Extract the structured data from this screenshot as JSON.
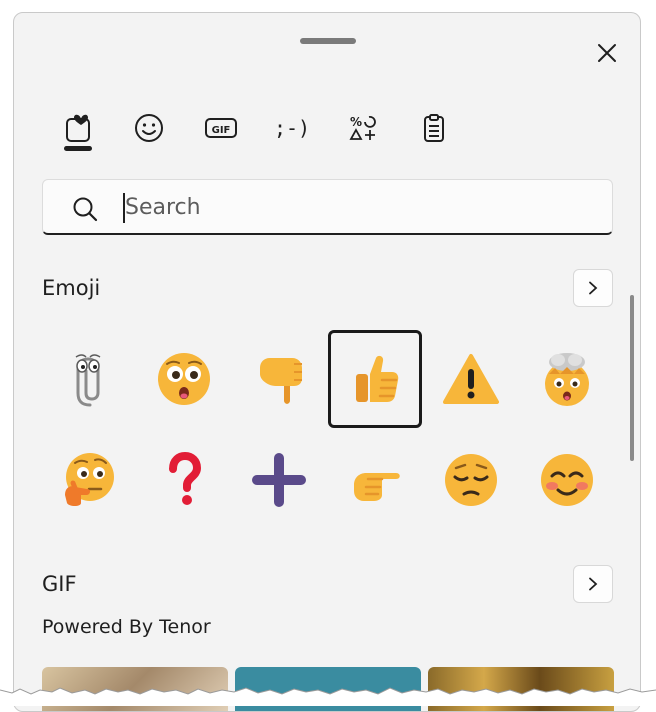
{
  "window": {
    "close_icon": "close-icon",
    "handle": "drag-handle"
  },
  "tabs": [
    {
      "name": "favorites",
      "icon": "heart-clipboard-icon",
      "active": true
    },
    {
      "name": "emoji",
      "icon": "smiley-icon",
      "active": false
    },
    {
      "name": "gif",
      "icon": "gif-icon",
      "label": "GIF",
      "active": false
    },
    {
      "name": "kaomoji",
      "icon": "kaomoji-icon",
      "label": ";-)",
      "active": false
    },
    {
      "name": "symbols",
      "icon": "symbols-icon",
      "label": "%↻Δ+",
      "active": false
    },
    {
      "name": "clipboard",
      "icon": "clipboard-icon",
      "active": false
    }
  ],
  "search": {
    "placeholder": "Search",
    "value": ""
  },
  "emoji_section": {
    "title": "Emoji",
    "items_row1": [
      {
        "name": "paperclip-character",
        "icon": "paperclip-icon"
      },
      {
        "name": "flushed-face",
        "icon": "flushed-face-icon"
      },
      {
        "name": "backhand-index-pointing-down",
        "icon": "pointing-down-icon"
      },
      {
        "name": "thumbs-up",
        "icon": "thumbs-up-icon",
        "selected": true
      },
      {
        "name": "warning",
        "icon": "warning-icon"
      },
      {
        "name": "exploding-head",
        "icon": "exploding-head-icon"
      }
    ],
    "items_row2": [
      {
        "name": "thinking-face",
        "icon": "thinking-face-icon"
      },
      {
        "name": "question-mark",
        "icon": "question-mark-icon"
      },
      {
        "name": "plus-sign",
        "icon": "plus-icon"
      },
      {
        "name": "backhand-index-pointing-right",
        "icon": "pointing-right-icon"
      },
      {
        "name": "pensive-face",
        "icon": "pensive-face-icon"
      },
      {
        "name": "smiling-face",
        "icon": "smiling-face-icon"
      }
    ]
  },
  "gif_section": {
    "title": "GIF",
    "subtitle": "Powered By Tenor"
  },
  "colors": {
    "panel_bg": "#f3f3f3",
    "emoji_yellow": "#f7b63a",
    "emoji_shade": "#e6952a",
    "plus_purple": "#5a4a8a",
    "question_red": "#e21d36"
  }
}
